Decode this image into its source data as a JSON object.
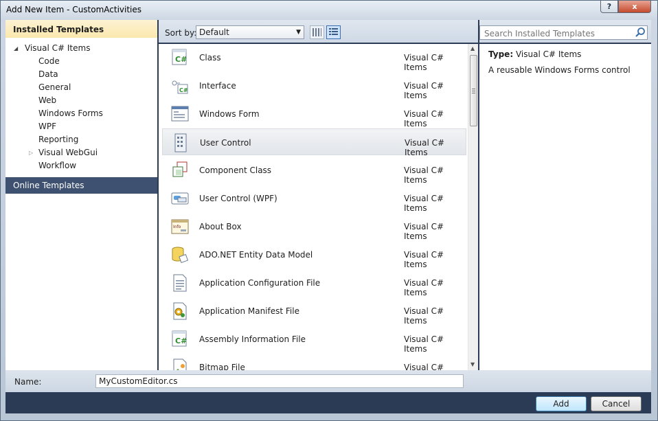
{
  "window": {
    "title": "Add New Item - CustomActivities",
    "help_glyph": "?",
    "close_glyph": "x"
  },
  "left": {
    "installed_header": "Installed Templates",
    "tree": [
      {
        "label": "Visual C# Items",
        "level": 0,
        "expanded": true
      },
      {
        "label": "Code",
        "level": 1
      },
      {
        "label": "Data",
        "level": 1
      },
      {
        "label": "General",
        "level": 1
      },
      {
        "label": "Web",
        "level": 1
      },
      {
        "label": "Windows Forms",
        "level": 1
      },
      {
        "label": "WPF",
        "level": 1
      },
      {
        "label": "Reporting",
        "level": 1
      },
      {
        "label": "Visual WebGui",
        "level": 1,
        "collapsed_arrow": true
      },
      {
        "label": "Workflow",
        "level": 1
      }
    ],
    "online_header": "Online Templates"
  },
  "toolbar": {
    "sort_label": "Sort by:",
    "sort_value": "Default"
  },
  "templates": [
    {
      "name": "Class",
      "category": "Visual C# Items",
      "icon": "class-icon"
    },
    {
      "name": "Interface",
      "category": "Visual C# Items",
      "icon": "interface-icon"
    },
    {
      "name": "Windows Form",
      "category": "Visual C# Items",
      "icon": "windows-form-icon"
    },
    {
      "name": "User Control",
      "category": "Visual C# Items",
      "icon": "user-control-icon",
      "selected": true
    },
    {
      "name": "Component Class",
      "category": "Visual C# Items",
      "icon": "component-class-icon"
    },
    {
      "name": "User Control (WPF)",
      "category": "Visual C# Items",
      "icon": "wpf-user-control-icon"
    },
    {
      "name": "About Box",
      "category": "Visual C# Items",
      "icon": "about-box-icon"
    },
    {
      "name": "ADO.NET Entity Data Model",
      "category": "Visual C# Items",
      "icon": "entity-data-model-icon"
    },
    {
      "name": "Application Configuration File",
      "category": "Visual C# Items",
      "icon": "config-file-icon"
    },
    {
      "name": "Application Manifest File",
      "category": "Visual C# Items",
      "icon": "manifest-file-icon"
    },
    {
      "name": "Assembly Information File",
      "category": "Visual C# Items",
      "icon": "assembly-info-icon"
    },
    {
      "name": "Bitmap File",
      "category": "Visual C# Items",
      "icon": "bitmap-file-icon"
    }
  ],
  "search": {
    "placeholder": "Search Installed Templates"
  },
  "details": {
    "type_label": "Type:",
    "type_value": "Visual C# Items",
    "description": "A reusable Windows Forms control"
  },
  "name_field": {
    "label": "Name:",
    "value": "MyCustomEditor.cs"
  },
  "buttons": {
    "add": "Add",
    "cancel": "Cancel"
  },
  "colors": {
    "selected_header": "#fbe7ad",
    "online_header": "#3e5170",
    "frame": "#2b3a55"
  }
}
